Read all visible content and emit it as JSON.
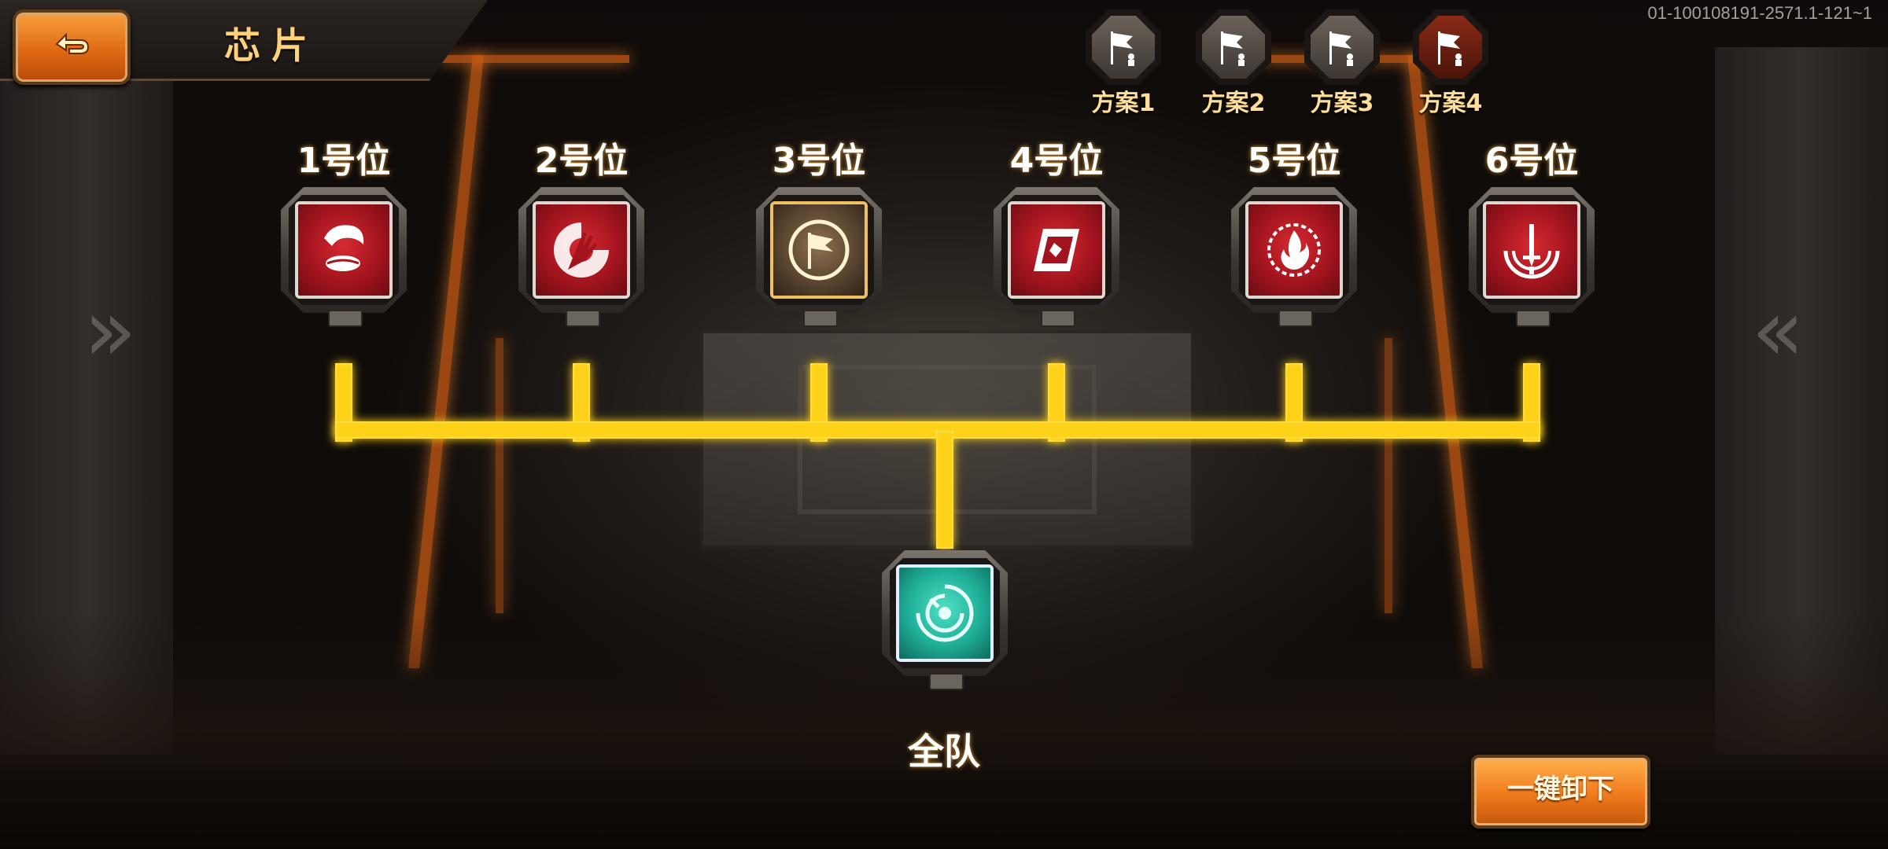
{
  "header": {
    "title": "芯片",
    "version": "01-100108191-2571.1-121~1"
  },
  "plans": [
    {
      "label": "方案1",
      "active": false
    },
    {
      "label": "方案2",
      "active": false
    },
    {
      "label": "方案3",
      "active": false
    },
    {
      "label": "方案4",
      "active": true
    }
  ],
  "slots": [
    {
      "label": "1号位",
      "chip_color": "red",
      "icon": "skull-lips-icon"
    },
    {
      "label": "2号位",
      "chip_color": "red",
      "icon": "hand-icon"
    },
    {
      "label": "3号位",
      "chip_color": "gold",
      "icon": "flag-emblem-icon"
    },
    {
      "label": "4号位",
      "chip_color": "red",
      "icon": "card-icon"
    },
    {
      "label": "5号位",
      "chip_color": "red",
      "icon": "flame-icon"
    },
    {
      "label": "6号位",
      "chip_color": "red",
      "icon": "sword-icon"
    }
  ],
  "team": {
    "label": "全队",
    "chip_color": "teal",
    "icon": "vortex-icon"
  },
  "actions": {
    "unload_all": "一键卸下"
  },
  "colors": {
    "accent": "#ffd21a",
    "button_orange": "#f07a1c",
    "chip_red": "#a3141e",
    "chip_teal": "#1fae98",
    "chip_gold": "#5a4530"
  }
}
